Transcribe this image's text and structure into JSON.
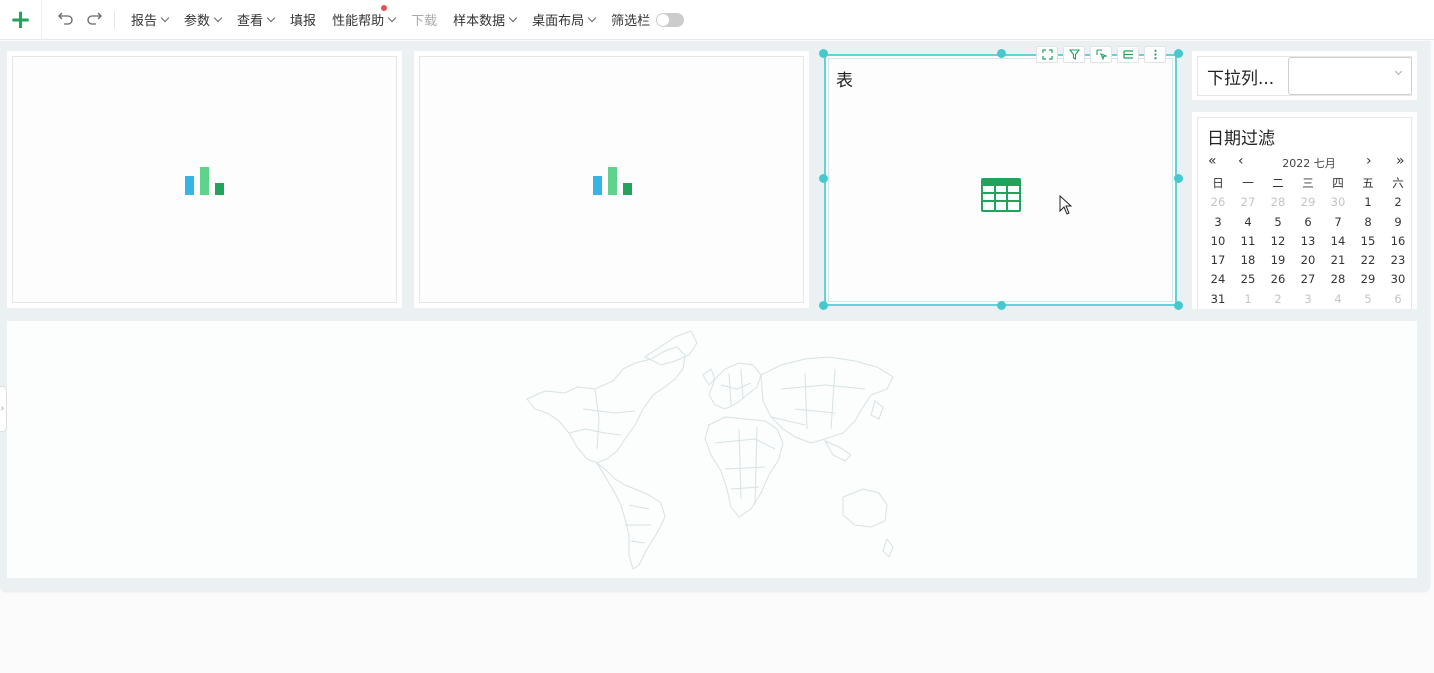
{
  "toolbar": {
    "add_label": "+",
    "undo_icon": "undo-icon",
    "redo_icon": "redo-icon",
    "report": "报告",
    "params": "参数",
    "view": "查看",
    "fill": "填报",
    "perf_help": "性能帮助",
    "download": "下载",
    "sample_data": "样本数据",
    "desktop_layout": "桌面布局",
    "filter_bar": "筛选栏"
  },
  "colors": {
    "accent": "#21a35b",
    "selection": "#45c9cf",
    "bar_blue": "#34b5e5",
    "bar_green_light": "#5fd38d",
    "bar_green_dark": "#21a35b"
  },
  "cards": {
    "table_title": "表",
    "tools": [
      "expand-icon",
      "filter-icon",
      "select-icon",
      "list-icon",
      "more-icon"
    ]
  },
  "dropdown": {
    "label": "下拉列...",
    "value": ""
  },
  "date_filter": {
    "title": "日期过滤",
    "month": "2022 七月",
    "weekdays": [
      "日",
      "一",
      "二",
      "三",
      "四",
      "五",
      "六"
    ],
    "days": [
      [
        "26",
        "27",
        "28",
        "29",
        "30",
        "1",
        "2"
      ],
      [
        "3",
        "4",
        "5",
        "6",
        "7",
        "8",
        "9"
      ],
      [
        "10",
        "11",
        "12",
        "13",
        "14",
        "15",
        "16"
      ],
      [
        "17",
        "18",
        "19",
        "20",
        "21",
        "22",
        "23"
      ],
      [
        "24",
        "25",
        "26",
        "27",
        "28",
        "29",
        "30"
      ],
      [
        "31",
        "1",
        "2",
        "3",
        "4",
        "5",
        "6"
      ]
    ]
  }
}
